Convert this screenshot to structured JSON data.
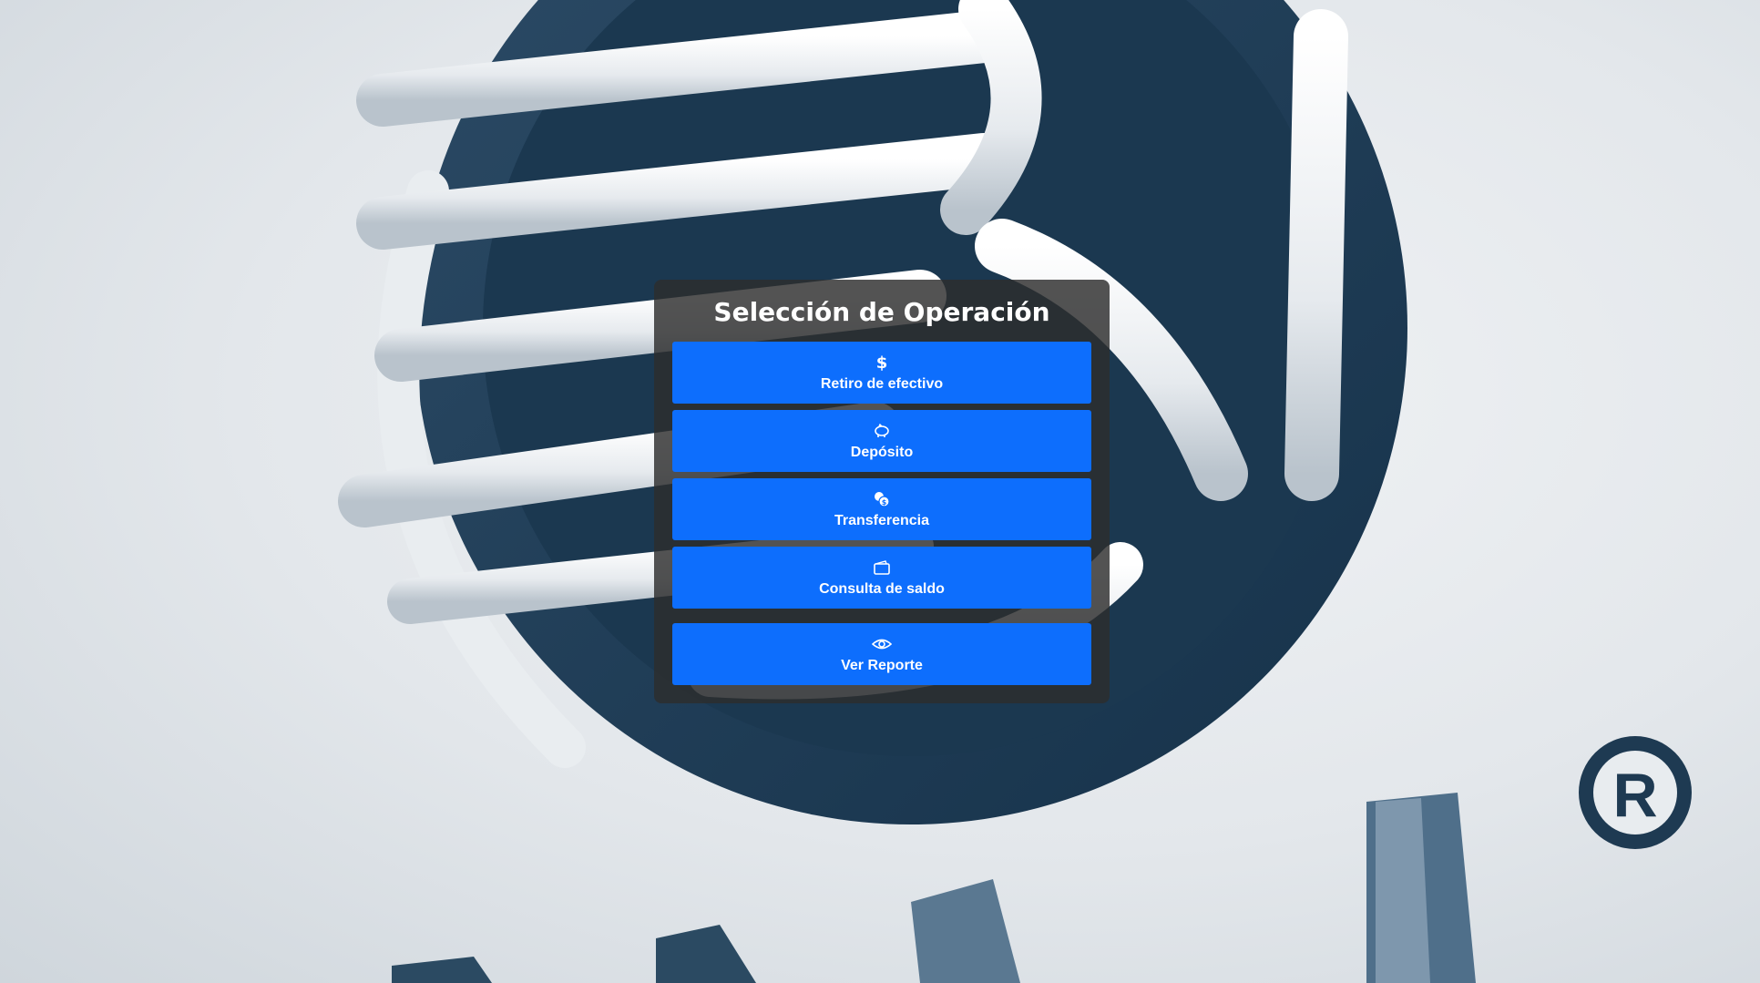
{
  "panel": {
    "title": "Selección de Operación"
  },
  "operations": [
    {
      "label": "Retiro de efectivo",
      "icon": "dollar-icon"
    },
    {
      "label": "Depósito",
      "icon": "piggy-bank-icon"
    },
    {
      "label": "Transferencia",
      "icon": "coins-icon"
    },
    {
      "label": "Consulta de saldo",
      "icon": "wallet-icon"
    },
    {
      "label": "Ver Reporte",
      "icon": "eye-icon"
    }
  ],
  "background": {
    "description_icon": "bank-logo-background",
    "registered_mark": "R"
  },
  "colors": {
    "button": "#0d6efd",
    "panel": "#2d2d2d",
    "logo_dark": "#1e3a52",
    "logo_light": "#f2f4f6"
  }
}
